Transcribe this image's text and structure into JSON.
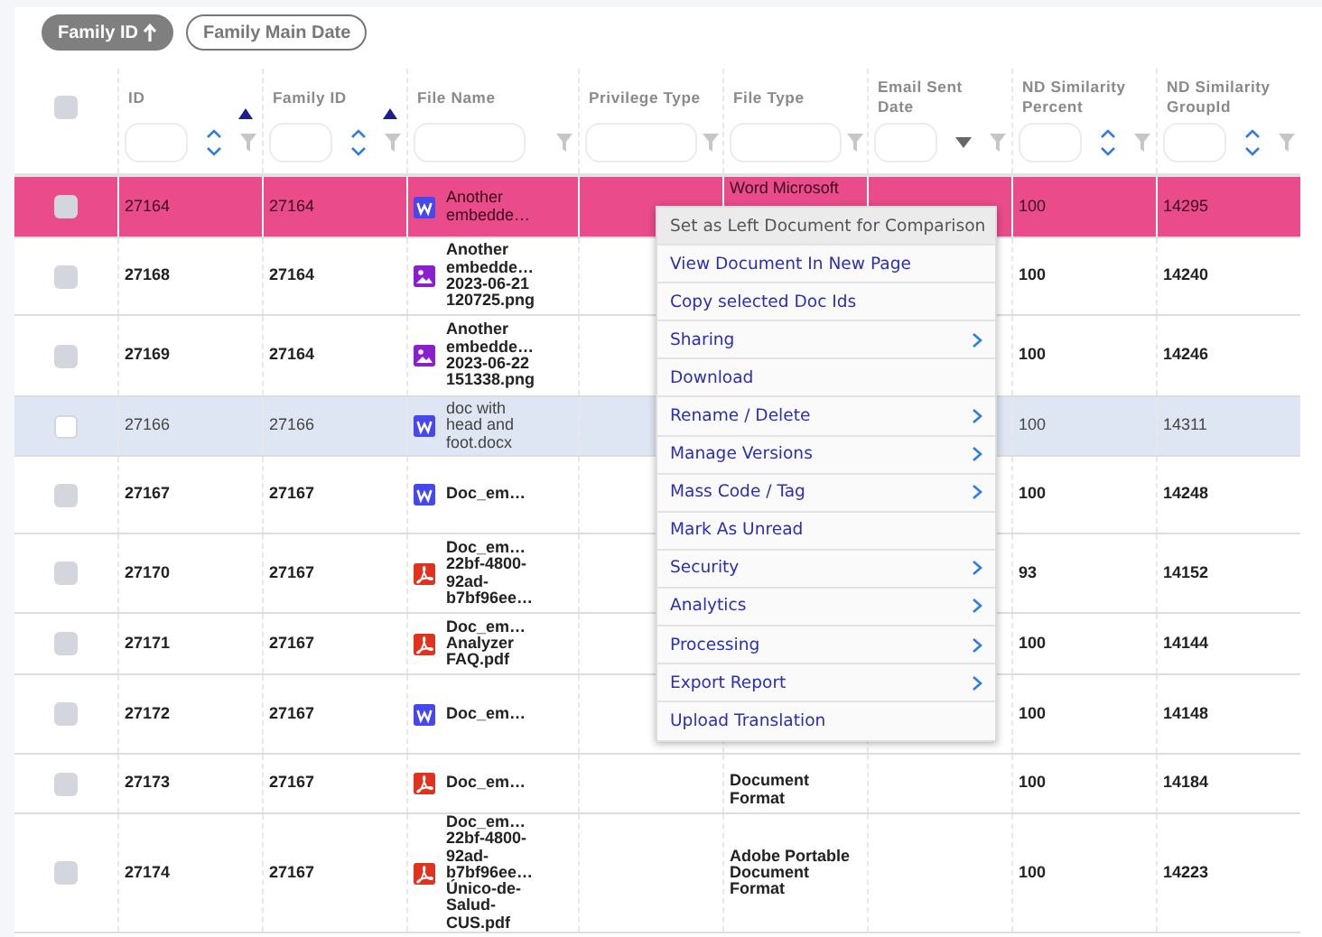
{
  "sort_pills": [
    {
      "label": "Family ID",
      "active": true
    },
    {
      "label": "Family Main Date",
      "active": false
    }
  ],
  "select_all": {
    "checked": false
  },
  "columns": [
    {
      "label": "ID",
      "kind": "number",
      "sorted": true
    },
    {
      "label": "Family ID",
      "kind": "number",
      "sorted": true
    },
    {
      "label": "File Name",
      "kind": "text",
      "sorted": false
    },
    {
      "label": "Privilege Type",
      "kind": "text",
      "sorted": false
    },
    {
      "label": "File Type",
      "kind": "text",
      "sorted": false
    },
    {
      "label": "Email Sent Date",
      "kind": "date",
      "sorted": false
    },
    {
      "label": "ND Similarity Percent",
      "kind": "number",
      "sorted": false
    },
    {
      "label": "ND Similarity GroupId",
      "kind": "number",
      "sorted": false
    }
  ],
  "rows": [
    {
      "id": "27164",
      "family_id": "27164",
      "kind": "word",
      "file_name": "Another\nembedde…",
      "file_type": "Word Microsoft",
      "similarity_percent": "100",
      "similarity_group": "14295",
      "selected": true,
      "highlighted": false,
      "read": true
    },
    {
      "id": "27168",
      "family_id": "27164",
      "kind": "image",
      "file_name": "Another\nembedde…\n2023-06-21\n120725.png",
      "similarity_percent": "100",
      "similarity_group": "14240",
      "selected": false,
      "highlighted": false,
      "read": false
    },
    {
      "id": "27169",
      "family_id": "27164",
      "kind": "image",
      "file_name": "Another\nembedde…\n2023-06-22\n151338.png",
      "similarity_percent": "100",
      "similarity_group": "14246",
      "selected": false,
      "highlighted": false,
      "read": false
    },
    {
      "id": "27166",
      "family_id": "27166",
      "kind": "word",
      "file_name": "doc with\nhead and\nfoot.docx",
      "similarity_percent": "100",
      "similarity_group": "14311",
      "selected": false,
      "highlighted": true,
      "read": true
    },
    {
      "id": "27167",
      "family_id": "27167",
      "kind": "word",
      "file_name": "Doc_em…",
      "similarity_percent": "100",
      "similarity_group": "14248",
      "selected": false,
      "highlighted": false,
      "read": false
    },
    {
      "id": "27170",
      "family_id": "27167",
      "kind": "pdf",
      "file_name": "Doc_em…\n22bf-4800-\n92ad-\nb7bf96ee…",
      "similarity_percent": "93",
      "similarity_group": "14152",
      "selected": false,
      "highlighted": false,
      "read": false
    },
    {
      "id": "27171",
      "family_id": "27167",
      "kind": "pdf",
      "file_name": "Doc_em…\nAnalyzer\nFAQ.pdf",
      "similarity_percent": "100",
      "similarity_group": "14144",
      "selected": false,
      "highlighted": false,
      "read": false
    },
    {
      "id": "27172",
      "family_id": "27167",
      "kind": "word",
      "file_name": "Doc_em…",
      "similarity_percent": "100",
      "similarity_group": "14148",
      "selected": false,
      "highlighted": false,
      "read": false
    },
    {
      "id": "27173",
      "family_id": "27167",
      "kind": "pdf",
      "file_name": "Doc_em…",
      "file_type": "Document\nFormat",
      "similarity_percent": "100",
      "similarity_group": "14184",
      "selected": false,
      "highlighted": false,
      "read": false
    },
    {
      "id": "27174",
      "family_id": "27167",
      "kind": "pdf",
      "file_name": "Doc_em…\n22bf-4800-\n92ad-\nb7bf96ee…\nÚnico-de-\nSalud-\nCUS.pdf",
      "file_type": "Adobe Portable\nDocument\nFormat",
      "similarity_percent": "100",
      "similarity_group": "14223",
      "selected": false,
      "highlighted": false,
      "read": false
    }
  ],
  "context_menu": [
    {
      "label": "Set as Left Document for Comparison",
      "submenu": false,
      "hovered": true
    },
    {
      "label": "View Document In New Page",
      "submenu": false,
      "hovered": false
    },
    {
      "label": "Copy selected Doc Ids",
      "submenu": false,
      "hovered": false
    },
    {
      "label": "Sharing",
      "submenu": true,
      "hovered": false
    },
    {
      "label": "Download",
      "submenu": false,
      "hovered": false
    },
    {
      "label": "Rename / Delete",
      "submenu": true,
      "hovered": false
    },
    {
      "label": "Manage Versions",
      "submenu": true,
      "hovered": false
    },
    {
      "label": "Mass Code / Tag",
      "submenu": true,
      "hovered": false
    },
    {
      "label": "Mark As Unread",
      "submenu": false,
      "hovered": false
    },
    {
      "label": "Security",
      "submenu": true,
      "hovered": false
    },
    {
      "label": "Analytics",
      "submenu": true,
      "hovered": false
    },
    {
      "label": "Processing",
      "submenu": true,
      "hovered": false
    },
    {
      "label": "Export Report",
      "submenu": true,
      "hovered": false
    },
    {
      "label": "Upload Translation",
      "submenu": false,
      "hovered": false
    }
  ]
}
